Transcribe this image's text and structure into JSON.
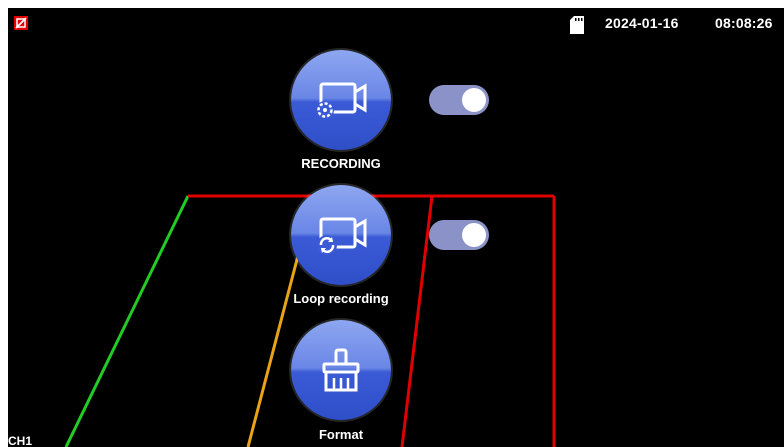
{
  "status_bar": {
    "left_icon": "no-audio-icon",
    "sd_icon": "sd-card-icon",
    "date": "2024-01-16",
    "time": "08:08:26"
  },
  "camera": {
    "channel_label": "CH1"
  },
  "menu": {
    "items": [
      {
        "label": "RECORDING",
        "icon": "recording-settings-icon",
        "toggle_on": true
      },
      {
        "label": "Loop recording",
        "icon": "loop-recording-icon",
        "toggle_on": true
      },
      {
        "label": "Format",
        "icon": "format-broom-icon"
      }
    ]
  },
  "colors": {
    "background": "#000000",
    "button_blue": "#3b5ad6",
    "toggle_track": "#8a92c8",
    "guide_green": "#22cc22",
    "guide_yellow": "#e8a317",
    "guide_red": "#e00000"
  }
}
